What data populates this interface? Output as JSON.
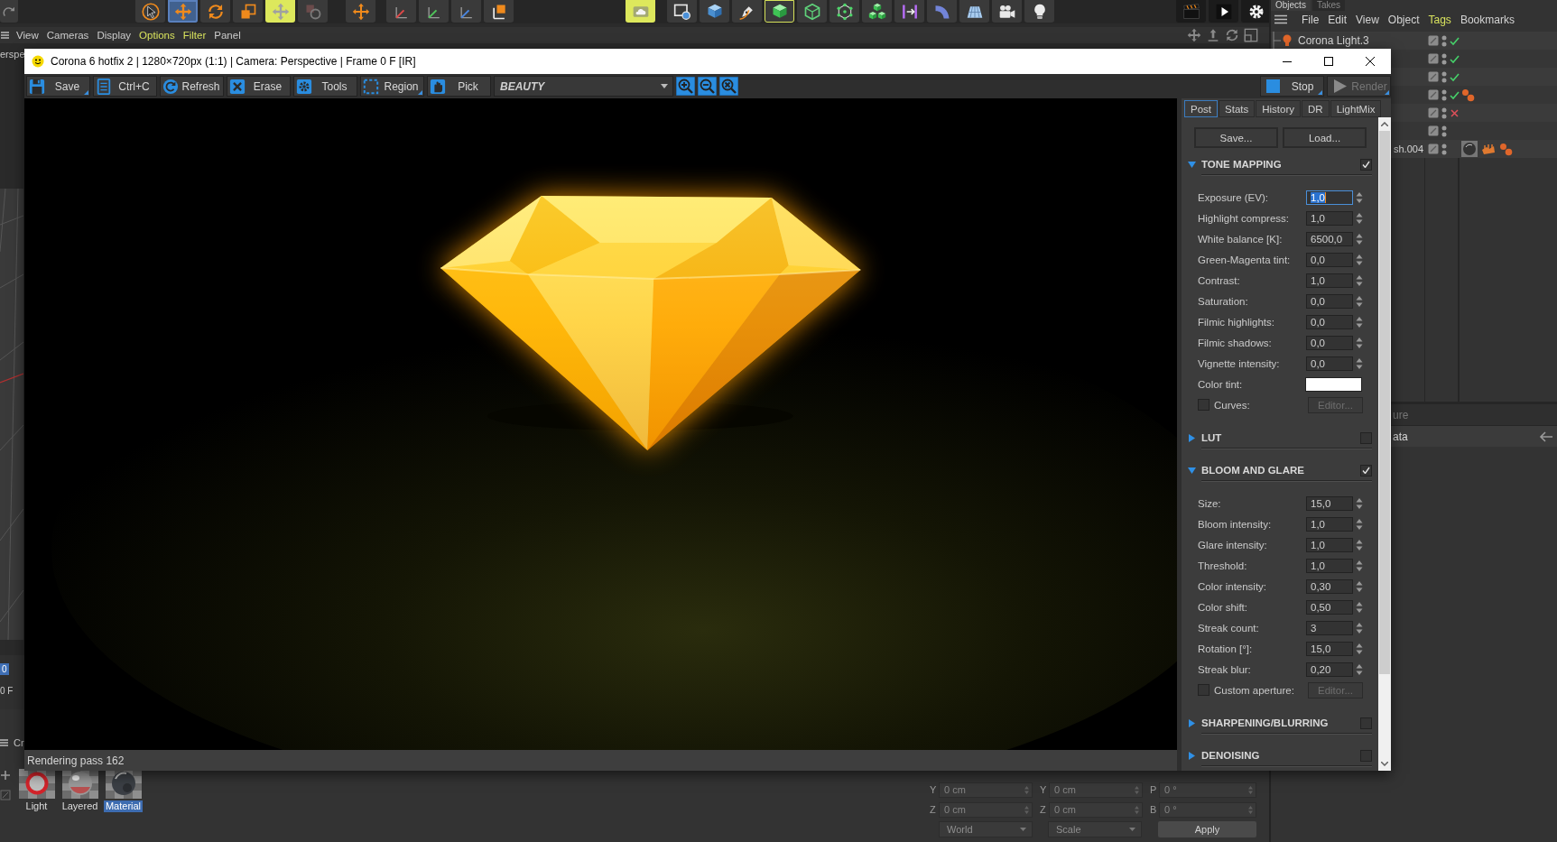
{
  "main_toolbar": {
    "tools": [
      {
        "selected": false,
        "toggled": false,
        "framed": false
      },
      {
        "selected": false,
        "toggled": false,
        "framed": false
      },
      {
        "selected": true,
        "toggled": false,
        "framed": false
      },
      {
        "selected": false,
        "toggled": false,
        "framed": false
      },
      {
        "selected": false,
        "toggled": false,
        "framed": false
      },
      {
        "selected": false,
        "toggled": true,
        "framed": false
      },
      {
        "selected": false,
        "toggled": false,
        "framed": false
      },
      {
        "selected": false,
        "toggled": false,
        "framed": false
      },
      {
        "selected": false,
        "toggled": false,
        "framed": false
      },
      {
        "selected": false,
        "toggled": false,
        "framed": false
      },
      {
        "selected": false,
        "toggled": false,
        "framed": false
      },
      {
        "selected": false,
        "toggled": false,
        "framed": false
      },
      {
        "selected": false,
        "toggled": true,
        "framed": false
      },
      {
        "selected": false,
        "toggled": false,
        "framed": false
      },
      {
        "selected": false,
        "toggled": false,
        "framed": false
      },
      {
        "selected": false,
        "toggled": false,
        "framed": false
      },
      {
        "selected": false,
        "toggled": false,
        "framed": true
      },
      {
        "selected": false,
        "toggled": false,
        "framed": false
      },
      {
        "selected": false,
        "toggled": false,
        "framed": false
      },
      {
        "selected": false,
        "toggled": false,
        "framed": false
      },
      {
        "selected": false,
        "toggled": false,
        "framed": false
      },
      {
        "selected": false,
        "toggled": false,
        "framed": false
      },
      {
        "selected": false,
        "toggled": false,
        "framed": false
      },
      {
        "selected": false,
        "toggled": false,
        "framed": false
      },
      {
        "selected": false,
        "toggled": false,
        "framed": false
      },
      {
        "selected": false,
        "toggled": false,
        "framed": false
      },
      {
        "selected": false,
        "toggled": false,
        "framed": false
      },
      {
        "selected": false,
        "toggled": false,
        "framed": false
      }
    ]
  },
  "viewport": {
    "menu": [
      {
        "label": "View",
        "active": false
      },
      {
        "label": "Cameras",
        "active": false
      },
      {
        "label": "Display",
        "active": false
      },
      {
        "label": "Options",
        "active": true
      },
      {
        "label": "Filter",
        "active": true
      },
      {
        "label": "Panel",
        "active": false
      }
    ],
    "camera_label": "erspe"
  },
  "timeline": {
    "marker": "0",
    "frame": "0 F"
  },
  "material_manager": {
    "menu_label": "Cr",
    "materials": [
      {
        "name": "Light",
        "kind": "light",
        "selected": false
      },
      {
        "name": "Layered",
        "kind": "layered",
        "selected": false
      },
      {
        "name": "Material",
        "kind": "standard",
        "selected": true
      }
    ]
  },
  "coordinate_manager": {
    "rows": [
      [
        {
          "axis": "Y",
          "value": "0 cm"
        },
        {
          "axis": "Y",
          "value": "0 cm"
        },
        {
          "axis": "P",
          "value": "0 °"
        }
      ],
      [
        {
          "axis": "Z",
          "value": "0 cm"
        },
        {
          "axis": "Z",
          "value": "0 cm"
        },
        {
          "axis": "B",
          "value": "0 °"
        }
      ]
    ],
    "dropdowns": [
      "World",
      "Scale"
    ],
    "apply": "Apply"
  },
  "object_manager": {
    "tabs": [
      {
        "label": "Objects",
        "selected": true
      },
      {
        "label": "Takes",
        "selected": false
      }
    ],
    "menu": [
      {
        "label": "File",
        "active": false
      },
      {
        "label": "Edit",
        "active": false
      },
      {
        "label": "View",
        "active": false
      },
      {
        "label": "Object",
        "active": false
      },
      {
        "label": "Tags",
        "active": true
      },
      {
        "label": "Bookmarks",
        "active": false
      }
    ],
    "objects": [
      {
        "name": "Corona Light.3",
        "covered": false,
        "enabled": true,
        "disabled": false
      },
      {
        "enabled": true,
        "disabled": false
      },
      {
        "enabled": true,
        "disabled": false
      },
      {
        "enabled": true,
        "disabled": false,
        "tags": [
          {
            "kind": "spheres"
          }
        ]
      },
      {
        "enabled": false,
        "disabled": true
      },
      {
        "enabled": false,
        "disabled": false
      },
      {
        "name": "sh.004",
        "covered": true,
        "enabled": false,
        "disabled": false,
        "tags": [
          {
            "kind": "material"
          },
          {
            "kind": "patch"
          },
          {
            "kind": "spheres"
          }
        ]
      }
    ],
    "attributes": [
      {
        "label": "ure",
        "dimmed": true
      },
      {
        "label": "ata",
        "dimmed": false
      }
    ]
  },
  "render_window": {
    "title": "Corona 6 hotfix 2 | 1280×720px (1:1) | Camera: Perspective | Frame 0 F [IR]",
    "toolbar": [
      {
        "label": "Save",
        "menu": true
      },
      {
        "label": "Ctrl+C",
        "menu": false
      },
      {
        "label": "Refresh",
        "menu": false
      },
      {
        "label": "Erase",
        "menu": false
      },
      {
        "label": "Tools",
        "menu": false
      },
      {
        "label": "Region",
        "menu": true
      },
      {
        "label": "Pick",
        "menu": false
      }
    ],
    "channel": "BEAUTY",
    "actions": [
      {
        "label": "Stop",
        "disabled": false,
        "menu": true
      },
      {
        "label": "Render",
        "disabled": true,
        "menu": true
      }
    ],
    "panel": {
      "tabs": [
        {
          "label": "Post",
          "selected": true
        },
        {
          "label": "Stats",
          "selected": false
        },
        {
          "label": "History",
          "selected": false
        },
        {
          "label": "DR",
          "selected": false
        },
        {
          "label": "LightMix",
          "selected": false
        }
      ],
      "buttons": [
        "Save...",
        "Load..."
      ],
      "sections": [
        {
          "title": "TONE MAPPING",
          "expanded": true,
          "checked": true,
          "fields": [
            {
              "kind": "spinner",
              "label": "Exposure (EV):",
              "value": "1,0",
              "focused": true
            },
            {
              "kind": "spinner",
              "label": "Highlight compress:",
              "value": "1,0",
              "focused": false
            },
            {
              "kind": "spinner",
              "label": "White balance [K]:",
              "value": "6500,0",
              "focused": false
            },
            {
              "kind": "spinner",
              "label": "Green-Magenta tint:",
              "value": "0,0",
              "focused": false
            },
            {
              "kind": "spinner",
              "label": "Contrast:",
              "value": "1,0",
              "focused": false
            },
            {
              "kind": "spinner",
              "label": "Saturation:",
              "value": "0,0",
              "focused": false
            },
            {
              "kind": "spinner",
              "label": "Filmic highlights:",
              "value": "0,0",
              "focused": false
            },
            {
              "kind": "spinner",
              "label": "Filmic shadows:",
              "value": "0,0",
              "focused": false
            },
            {
              "kind": "spinner",
              "label": "Vignette intensity:",
              "value": "0,0",
              "focused": false
            },
            {
              "kind": "color",
              "label": "Color tint:",
              "color": "#ffffff"
            },
            {
              "kind": "checkbox",
              "label": "Curves:",
              "checked": false,
              "button": {
                "label": "Editor...",
                "disabled": true
              }
            }
          ]
        },
        {
          "title": "LUT",
          "expanded": false,
          "checked": false
        },
        {
          "title": "BLOOM AND GLARE",
          "expanded": true,
          "checked": true,
          "fields": [
            {
              "kind": "spinner",
              "label": "Size:",
              "value": "15,0",
              "focused": false
            },
            {
              "kind": "spinner",
              "label": "Bloom intensity:",
              "value": "1,0",
              "focused": false
            },
            {
              "kind": "spinner",
              "label": "Glare intensity:",
              "value": "1,0",
              "focused": false
            },
            {
              "kind": "spinner",
              "label": "Threshold:",
              "value": "1,0",
              "focused": false
            },
            {
              "kind": "spinner",
              "label": "Color intensity:",
              "value": "0,30",
              "focused": false
            },
            {
              "kind": "spinner",
              "label": "Color shift:",
              "value": "0,50",
              "focused": false
            },
            {
              "kind": "spinner",
              "label": "Streak count:",
              "value": "3",
              "focused": false
            },
            {
              "kind": "spinner",
              "label": "Rotation [°]:",
              "value": "15,0",
              "focused": false
            },
            {
              "kind": "spinner",
              "label": "Streak blur:",
              "value": "0,20",
              "focused": false
            },
            {
              "kind": "checkbox",
              "label": "Custom aperture:",
              "checked": false,
              "button": {
                "label": "Editor...",
                "disabled": true
              }
            }
          ]
        },
        {
          "title": "SHARPENING/BLURRING",
          "expanded": false,
          "checked": false
        },
        {
          "title": "DENOISING",
          "expanded": false,
          "checked": false
        }
      ]
    },
    "status": "Rendering pass 162"
  }
}
